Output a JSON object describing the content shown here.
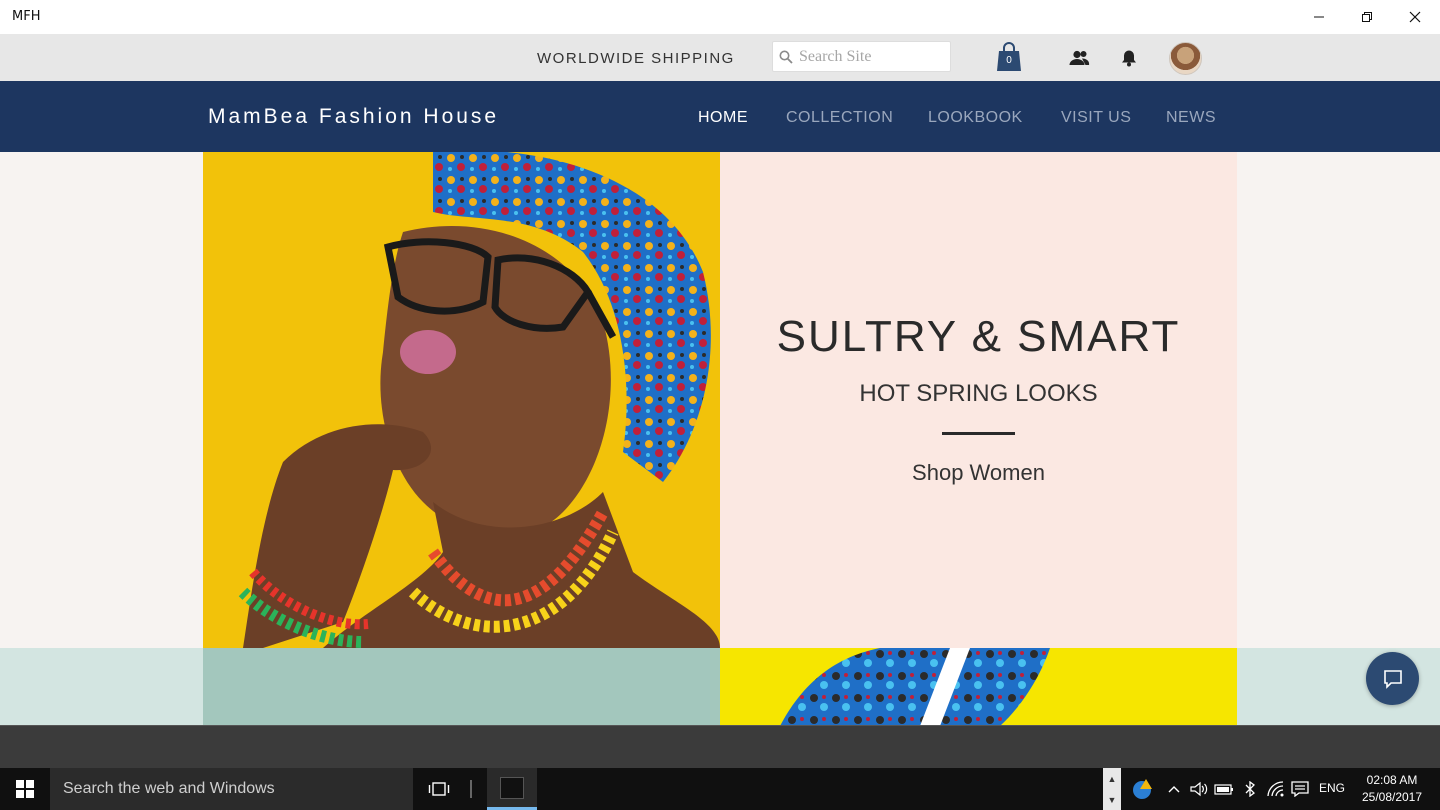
{
  "window": {
    "title": "MFH"
  },
  "topbar": {
    "shipping_text": "WORLDWIDE SHIPPING",
    "search_placeholder": "Search Site",
    "cart_count": "0"
  },
  "nav": {
    "brand": "MamBea Fashion House",
    "items": [
      {
        "label": "HOME",
        "active": true
      },
      {
        "label": "COLLECTION",
        "active": false
      },
      {
        "label": "LOOKBOOK",
        "active": false
      },
      {
        "label": "VISIT US",
        "active": false
      },
      {
        "label": "NEWS",
        "active": false
      }
    ]
  },
  "hero": {
    "heading": "SULTRY & SMART",
    "subheading": "HOT SPRING LOOKS",
    "cta": "Shop Women"
  },
  "taskbar": {
    "search_text": "Search the web and Windows",
    "language": "ENG",
    "time": "02:08 AM",
    "date": "25/08/2017"
  },
  "colors": {
    "nav_bg": "#1d3660",
    "hero_panel": "#fbe8e2",
    "hero_photo_bg": "#f2c20a",
    "strip_left": "#a3c7bd",
    "strip_right": "#f6e600",
    "chat_button": "#2c4a72"
  },
  "icons": {
    "search": "search-icon",
    "cart": "shopping-bag-icon",
    "members": "members-icon",
    "notifications": "bell-icon",
    "chat": "chat-icon",
    "start": "windows-logo-icon"
  }
}
